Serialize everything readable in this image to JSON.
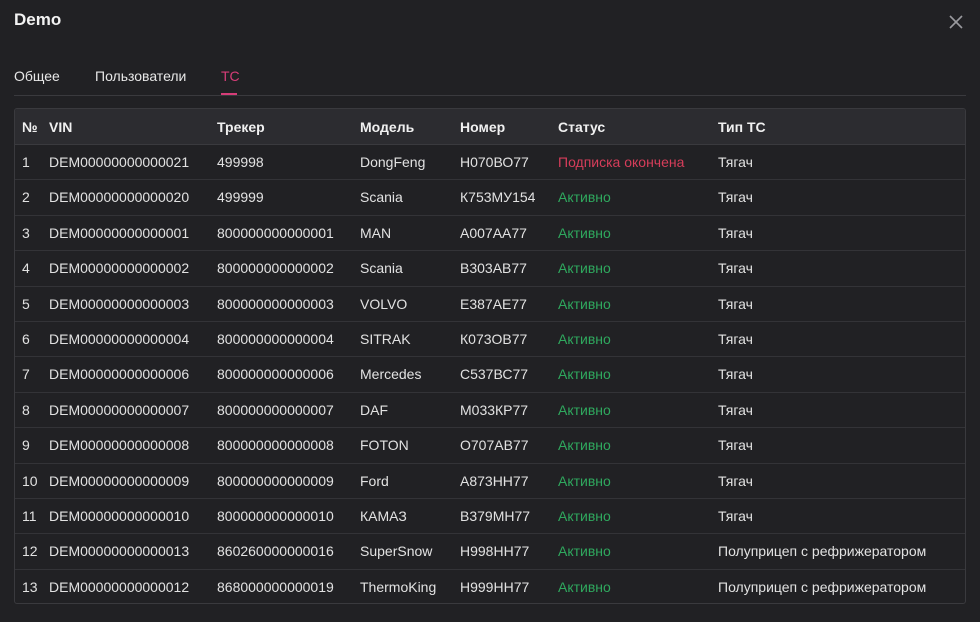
{
  "dialog": {
    "title": "Demo",
    "close_icon": "close-icon"
  },
  "tabs": [
    {
      "label": "Общее",
      "active": false
    },
    {
      "label": "Пользователи",
      "active": false
    },
    {
      "label": "ТС",
      "active": true
    }
  ],
  "colors": {
    "accent": "#d63d78",
    "active_status": "#2fa85e",
    "expired_status": "#d63d5a"
  },
  "table": {
    "headers": [
      "№",
      "VIN",
      "Трекер",
      "Модель",
      "Номер",
      "Статус",
      "Тип ТС"
    ],
    "rows": [
      {
        "num": "1",
        "vin": "DEM00000000000021",
        "tracker": "499998",
        "model": "DongFeng",
        "plate": "Н070ВО77",
        "status": "Подписка окончена",
        "status_kind": "expired",
        "type": "Тягач"
      },
      {
        "num": "2",
        "vin": "DEM00000000000020",
        "tracker": "499999",
        "model": "Scania",
        "plate": "К753МУ154",
        "status": "Активно",
        "status_kind": "active",
        "type": "Тягач"
      },
      {
        "num": "3",
        "vin": "DEM00000000000001",
        "tracker": "800000000000001",
        "model": "MAN",
        "plate": "А007АА77",
        "status": "Активно",
        "status_kind": "active",
        "type": "Тягач"
      },
      {
        "num": "4",
        "vin": "DEM00000000000002",
        "tracker": "800000000000002",
        "model": "Scania",
        "plate": "В303АВ77",
        "status": "Активно",
        "status_kind": "active",
        "type": "Тягач"
      },
      {
        "num": "5",
        "vin": "DEM00000000000003",
        "tracker": "800000000000003",
        "model": "VOLVO",
        "plate": "Е387АЕ77",
        "status": "Активно",
        "status_kind": "active",
        "type": "Тягач"
      },
      {
        "num": "6",
        "vin": "DEM00000000000004",
        "tracker": "800000000000004",
        "model": "SITRAK",
        "plate": "К073ОВ77",
        "status": "Активно",
        "status_kind": "active",
        "type": "Тягач"
      },
      {
        "num": "7",
        "vin": "DEM00000000000006",
        "tracker": "800000000000006",
        "model": "Mercedes",
        "plate": "С537ВС77",
        "status": "Активно",
        "status_kind": "active",
        "type": "Тягач"
      },
      {
        "num": "8",
        "vin": "DEM00000000000007",
        "tracker": "800000000000007",
        "model": "DAF",
        "plate": "М033КР77",
        "status": "Активно",
        "status_kind": "active",
        "type": "Тягач"
      },
      {
        "num": "9",
        "vin": "DEM00000000000008",
        "tracker": "800000000000008",
        "model": "FOTON",
        "plate": "О707АВ77",
        "status": "Активно",
        "status_kind": "active",
        "type": "Тягач"
      },
      {
        "num": "10",
        "vin": "DEM00000000000009",
        "tracker": "800000000000009",
        "model": "Ford",
        "plate": "А873НН77",
        "status": "Активно",
        "status_kind": "active",
        "type": "Тягач"
      },
      {
        "num": "11",
        "vin": "DEM00000000000010",
        "tracker": "800000000000010",
        "model": "КАМАЗ",
        "plate": "В379МН77",
        "status": "Активно",
        "status_kind": "active",
        "type": "Тягач"
      },
      {
        "num": "12",
        "vin": "DEM00000000000013",
        "tracker": "860260000000016",
        "model": "SuperSnow",
        "plate": "Н998НН77",
        "status": "Активно",
        "status_kind": "active",
        "type": "Полуприцеп с рефрижератором"
      },
      {
        "num": "13",
        "vin": "DEM00000000000012",
        "tracker": "868000000000019",
        "model": "ThermoKing",
        "plate": "Н999НН77",
        "status": "Активно",
        "status_kind": "active",
        "type": "Полуприцеп с рефрижератором"
      }
    ]
  }
}
